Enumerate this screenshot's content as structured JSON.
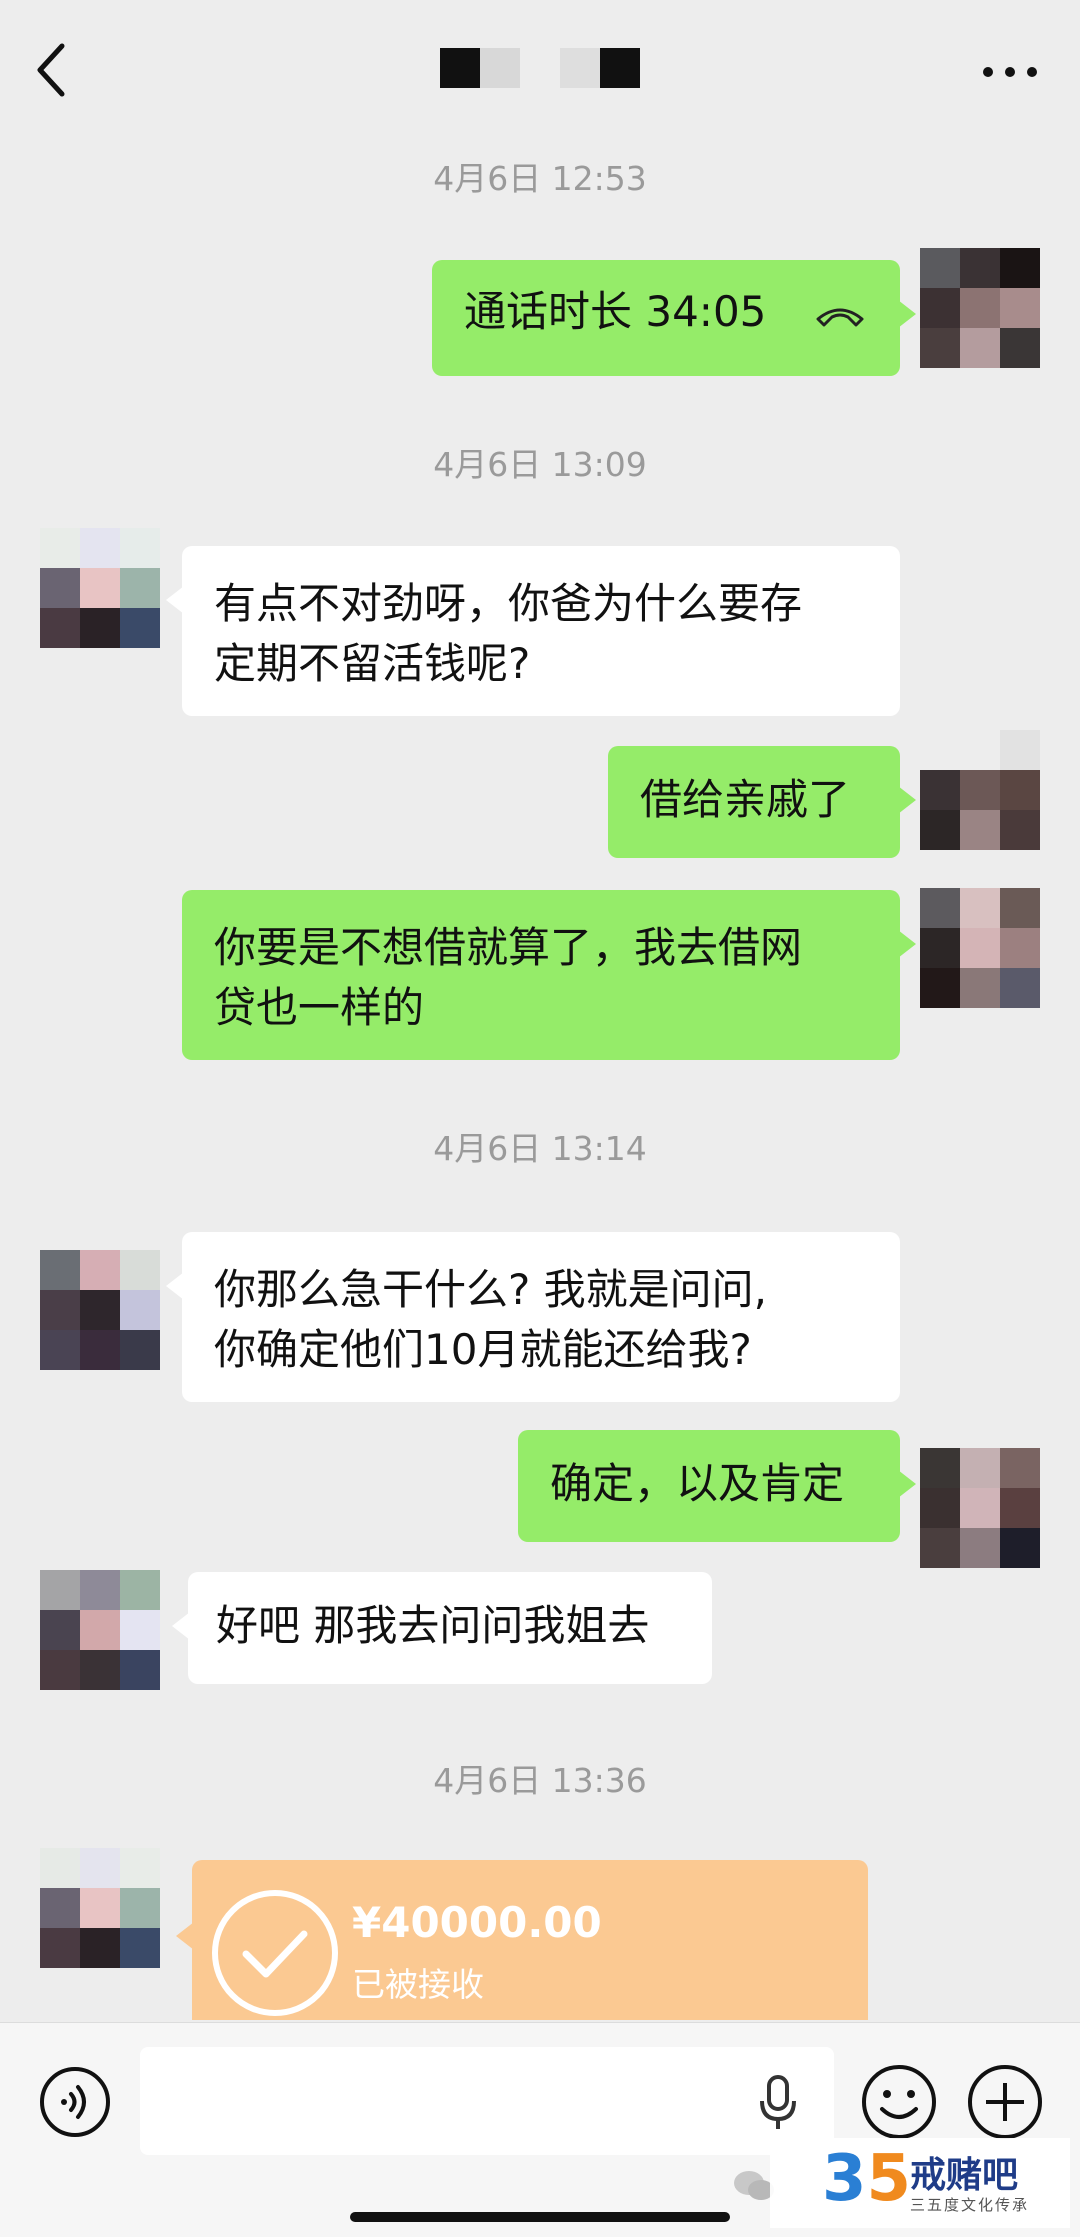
{
  "header": {
    "back_icon": "chevron-left-icon",
    "more_icon": "more-dots-icon",
    "title_blocks": [
      "#111111",
      "#d8d8d8",
      "#dedede",
      "#111111"
    ]
  },
  "messages": {
    "t1": "4月6日 12:53",
    "call_text": "通话时长 34:05",
    "t2": "4月6日 13:09",
    "m1_l1": "有点不对劲呀，你爸为什么要存",
    "m1_l2": "定期不留活钱呢?",
    "m2": "借给亲戚了",
    "m3_l1": "你要是不想借就算了，我去借网",
    "m3_l2": "贷也一样的",
    "t3": "4月6日 13:14",
    "m4_l1": "你那么急干什么? 我就是问问,",
    "m4_l2": "你确定他们10月就能还给我?",
    "m5": "确定，以及肯定",
    "m6": "好吧 那我去问问我姐去",
    "t4": "4月6日 13:36"
  },
  "transfer": {
    "amount": "¥40000.00",
    "status": "已被接收",
    "color": "#fbc992"
  },
  "input_bar": {
    "voice_icon": "voice-icon",
    "mic_icon": "mic-icon",
    "emoji_icon": "emoji-icon",
    "plus_icon": "plus-icon"
  },
  "watermark": {
    "number_a": "3",
    "number_b": "5",
    "title": "戒赌吧",
    "subtitle": "三五度文化传承"
  },
  "colors": {
    "self_bubble": "#95ec69",
    "other_bubble": "#ffffff",
    "background": "#ededed"
  }
}
